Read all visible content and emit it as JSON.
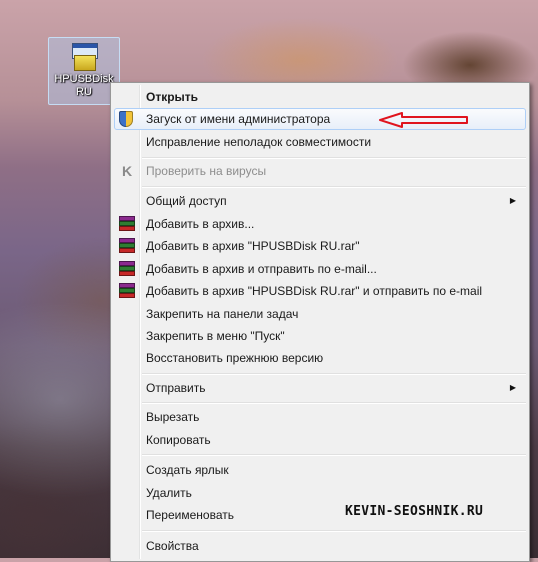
{
  "desktop_icon": {
    "label": "HPUSBDisk RU"
  },
  "context_menu": {
    "items": [
      {
        "label": "Открыть"
      },
      {
        "label": "Загуск от имени администратора"
      },
      {
        "label": "Исправление неполадок совместимости"
      },
      {
        "label": "Проверить на вирусы"
      },
      {
        "label": "Общий доступ"
      },
      {
        "label": "Добавить в архив..."
      },
      {
        "label": "Добавить в архив \"HPUSBDisk RU.rar\""
      },
      {
        "label": "Добавить в архив и отправить по e-mail..."
      },
      {
        "label": "Добавить в архив \"HPUSBDisk RU.rar\" и отправить по e-mail"
      },
      {
        "label": "Закрепить на панели задач"
      },
      {
        "label": "Закрепить в меню \"Пуск\""
      },
      {
        "label": "Восстановить прежнюю версию"
      },
      {
        "label": "Отправить"
      },
      {
        "label": "Вырезать"
      },
      {
        "label": "Копировать"
      },
      {
        "label": "Создать ярлык"
      },
      {
        "label": "Удалить"
      },
      {
        "label": "Переименовать"
      },
      {
        "label": "Свойства"
      }
    ],
    "submenu_arrow": "▶"
  },
  "watermark": "KEVIN-SEOSHNIK.RU",
  "colors": {
    "annotation_arrow": "#e0141e",
    "hover_border": "#aecff7"
  },
  "icons": [
    "uac-shield-icon",
    "antivirus-k-icon",
    "winrar-icon"
  ]
}
